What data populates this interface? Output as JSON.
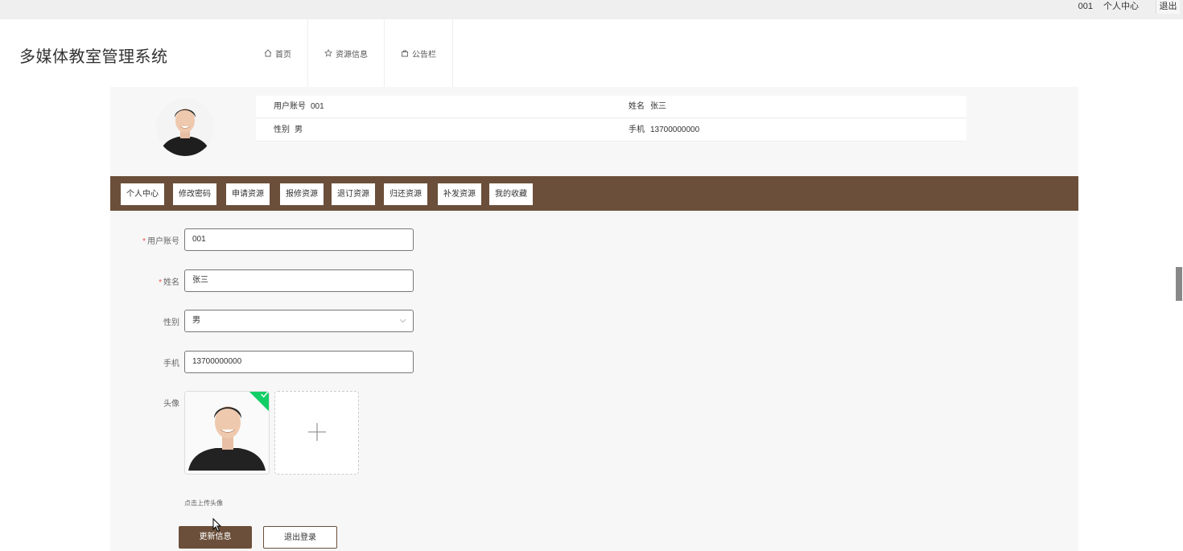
{
  "topbar": {
    "username": "001",
    "center_label": "个人中心",
    "logout_label": "退出"
  },
  "header": {
    "brand": "多媒体教室管理系统",
    "nav": [
      {
        "label": "首页",
        "icon": "home-icon"
      },
      {
        "label": "资源信息",
        "icon": "star-icon"
      },
      {
        "label": "公告栏",
        "icon": "bag-icon"
      }
    ]
  },
  "profile": {
    "account_label": "用户账号",
    "account_value": "001",
    "name_label": "姓名",
    "name_value": "张三",
    "gender_label": "性别",
    "gender_value": "男",
    "phone_label": "手机",
    "phone_value": "13700000000"
  },
  "tabs": [
    {
      "label": "个人中心",
      "active": true
    },
    {
      "label": "修改密码",
      "active": false
    },
    {
      "label": "申请资源",
      "active": false
    },
    {
      "label": "报修资源",
      "active": false
    },
    {
      "label": "退订资源",
      "active": false
    },
    {
      "label": "归还资源",
      "active": false
    },
    {
      "label": "补发资源",
      "active": false
    },
    {
      "label": "我的收藏",
      "active": false
    }
  ],
  "form": {
    "account_label": "用户账号",
    "account_value": "001",
    "name_label": "姓名",
    "name_value": "张三",
    "gender_label": "性别",
    "gender_value": "男",
    "phone_label": "手机",
    "phone_value": "13700000000",
    "avatar_label": "头像",
    "upload_hint": "点击上传头像",
    "required_mark": "*"
  },
  "buttons": {
    "update": "更新信息",
    "logout": "退出登录"
  },
  "colors": {
    "accent": "#6b4f3a",
    "upload_success": "#13ce66"
  }
}
